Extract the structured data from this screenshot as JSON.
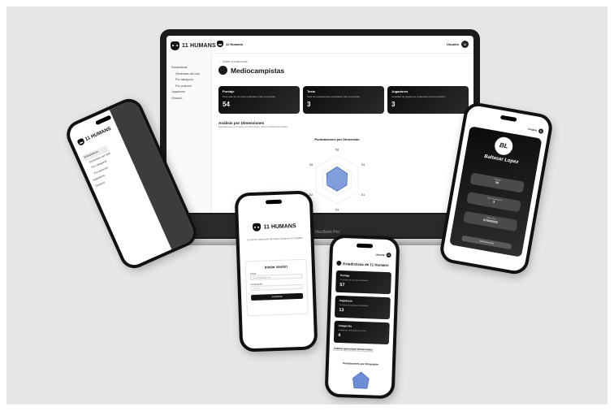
{
  "brand": {
    "name": "11 HUMANS"
  },
  "laptop": {
    "model_label": "MacBook Pro",
    "sidebar": {
      "items": [
        {
          "label": "Estadísticas"
        },
        {
          "label": "Generales del club"
        },
        {
          "label": "Por categoría"
        },
        {
          "label": "Por posición"
        },
        {
          "label": "Jugadores"
        },
        {
          "label": "Glosario"
        }
      ]
    },
    "topbar": {
      "brand": "11 Humans",
      "user": "Usuario",
      "avatar_initial": "U"
    },
    "back_link": "← Volver a posiciones",
    "page_title": "Mediocampistas",
    "cards": [
      {
        "title": "Puntaje",
        "desc": "Promedio de los tests realizados para la posición",
        "value": "54"
      },
      {
        "title": "Tests",
        "desc": "Total de evaluaciones realizadas para la posición",
        "value": "3"
      },
      {
        "title": "Jugadores",
        "desc": "Cantidad de jugadores evaluados para la posición",
        "value": "3"
      }
    ],
    "analysis": {
      "title": "Análisis por Dimensiones",
      "subtitle": "Evaluaciones promedio por dimensión para los Mediocampistas"
    },
    "chart_data": {
      "type": "radar",
      "title": "Puntuaciones por Dimensión",
      "values": [
        58,
        54,
        51,
        53,
        52,
        55
      ]
    }
  },
  "phone_left": {
    "brand": "11 HUMANS",
    "menu": [
      {
        "label": "Estadísticas"
      },
      {
        "label": "Generales del club"
      },
      {
        "label": "Por categoría"
      },
      {
        "label": "Por posición"
      },
      {
        "label": "Jugadores"
      },
      {
        "label": "Glosario"
      }
    ]
  },
  "phone_login": {
    "brand": "11 HUMANS",
    "tagline": "El primer explorador de datos humanos en el fútbol",
    "form": {
      "title": "Iniciar sesión",
      "email_label": "Email",
      "email_placeholder": "usuario@gmail.com",
      "password_label": "Contraseña",
      "password_placeholder": "••••••••••",
      "button": "Continuar"
    }
  },
  "phone_stats": {
    "user": "Usuario",
    "avatar_initial": "U",
    "title": "Estadísticas de 11 Humans",
    "cards": [
      {
        "title": "Puntaje",
        "desc": "Promedio de los tests realizados",
        "value": "57"
      },
      {
        "title": "Jugadores",
        "desc": "Cantidad de jugadores evaluados",
        "value": "13"
      },
      {
        "title": "Categorías",
        "desc": "Categorías evaluadas en el club",
        "value": "4"
      }
    ],
    "analysis": {
      "title": "Análisis general por Dimensiones",
      "subtitle": "Evaluaciones promedio por dimensión para el club"
    },
    "radar_title": "Puntuaciones por Dimensión"
  },
  "phone_player": {
    "user": "Usuario",
    "avatar_initial": "U",
    "initials": "BL",
    "name": "Baltasar Lopez",
    "stats": [
      {
        "label": "Puntaje",
        "value": "50"
      },
      {
        "label": "Tests Realizados",
        "value": "3"
      },
      {
        "label": "Último Test",
        "value": "07/04/2025"
      }
    ],
    "manage_button": "Gestionar tests"
  },
  "colors": {
    "dark_card": "#141414",
    "backdrop": "#e6e6e6",
    "radar_fill": "#6c8cd5"
  }
}
